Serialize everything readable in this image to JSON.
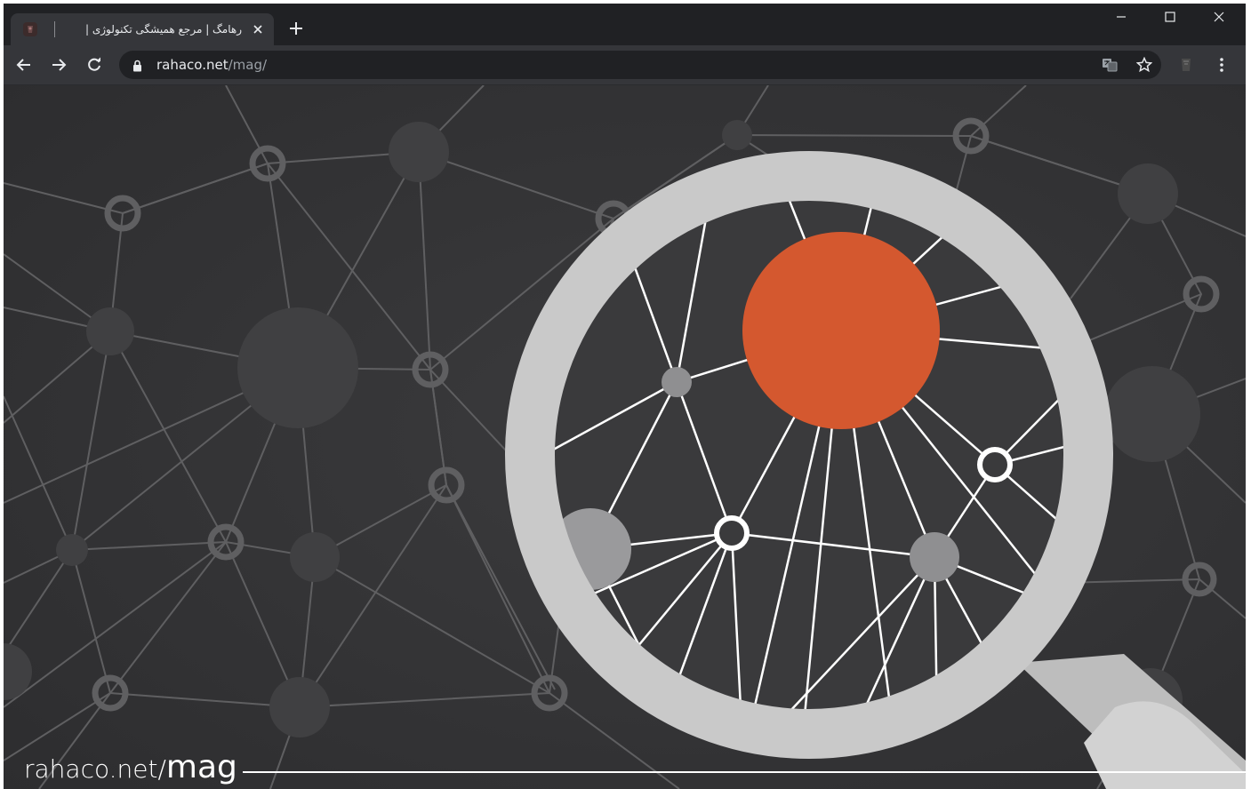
{
  "browser": {
    "tab": {
      "title": "رهامگ | مرجع همیشگی تکنولوژی |",
      "favicon": "rahaco-logo-icon"
    },
    "window_controls": [
      "minimize-icon",
      "maximize-icon",
      "close-icon"
    ],
    "toolbar": {
      "url_host": "rahaco.net",
      "url_path": "/mag/",
      "icons": [
        "back-arrow-icon",
        "forward-arrow-icon",
        "reload-icon",
        "lock-icon",
        "translate-icon",
        "star-icon",
        "extension-icon",
        "menu-dots-icon"
      ]
    }
  },
  "hero": {
    "caption_host": "rahaco.net/",
    "caption_path": "mag"
  },
  "colors": {
    "frame": "#202124",
    "toolbar": "#35363a",
    "background": "#333335",
    "highlight_node": "#d4582f",
    "magnifier": "#c9c9c9"
  }
}
